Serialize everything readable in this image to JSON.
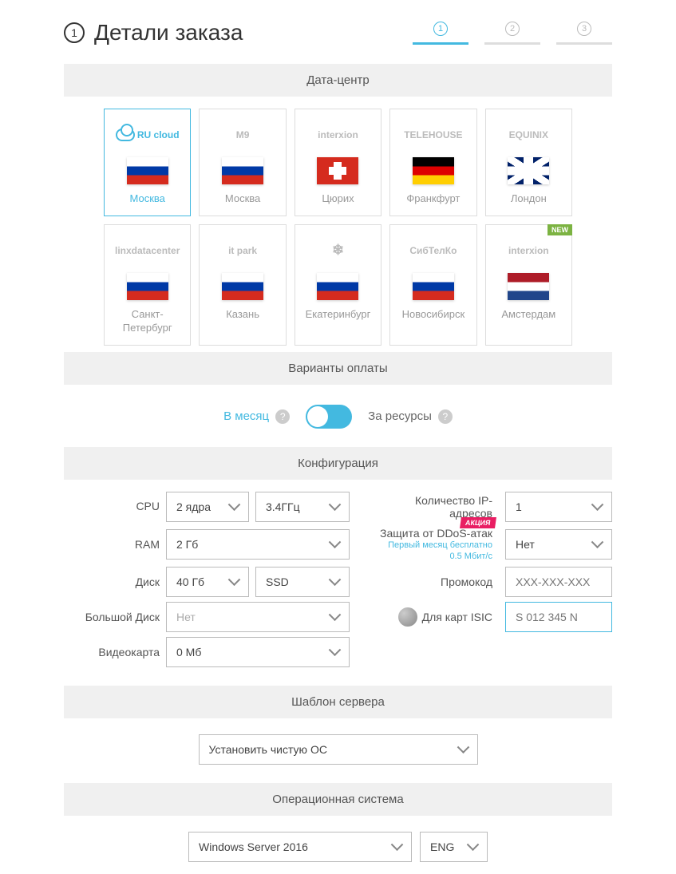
{
  "header": {
    "step_num": "1",
    "title": "Детали заказа",
    "tabs": [
      "1",
      "2",
      "3"
    ]
  },
  "sections": {
    "datacenter": "Дата-центр",
    "payment": "Варианты оплаты",
    "config": "Конфигурация",
    "template": "Шаблон сервера",
    "os": "Операционная система"
  },
  "datacenters": [
    {
      "logo": "RU cloud",
      "city": "Москва",
      "flag": "ru",
      "selected": true
    },
    {
      "logo": "М9",
      "city": "Москва",
      "flag": "ru"
    },
    {
      "logo": "interxion",
      "city": "Цюрих",
      "flag": "ch"
    },
    {
      "logo": "TELEHOUSE",
      "city": "Франкфурт",
      "flag": "de"
    },
    {
      "logo": "EQUINIX",
      "city": "Лондон",
      "flag": "uk"
    },
    {
      "logo": "linxdatacenter",
      "city": "Санкт-Петербург",
      "flag": "ru"
    },
    {
      "logo": "it park",
      "city": "Казань",
      "flag": "ru"
    },
    {
      "logo": "❄",
      "city": "Екатеринбург",
      "flag": "ru"
    },
    {
      "logo": "СибТелКо",
      "city": "Новосибирск",
      "flag": "ru"
    },
    {
      "logo": "interxion",
      "city": "Амстердам",
      "flag": "nl",
      "new": true
    }
  ],
  "payment": {
    "monthly": "В месяц",
    "resources": "За ресурсы",
    "new_badge": "NEW"
  },
  "config": {
    "cpu_label": "CPU",
    "cpu_cores": "2 ядра",
    "cpu_freq": "3.4ГГц",
    "ram_label": "RAM",
    "ram_value": "2 Гб",
    "disk_label": "Диск",
    "disk_size": "40 Гб",
    "disk_type": "SSD",
    "bigdisk_label": "Большой Диск",
    "bigdisk_value": "Нет",
    "gpu_label": "Видеокарта",
    "gpu_value": "0 Мб",
    "ip_label": "Количество IP-адресов",
    "ip_value": "1",
    "ddos_label": "Защита от DDoS-атак",
    "ddos_sub1": "Первый месяц бесплатно",
    "ddos_sub2": "0.5 Мбит/с",
    "ddos_value": "Нет",
    "ddos_badge": "АКЦИЯ",
    "promo_label": "Промокод",
    "promo_placeholder": "XXX-XXX-XXX",
    "isic_label": "Для карт ISIC",
    "isic_placeholder": "S 012 345 N"
  },
  "template": {
    "value": "Установить чистую ОС"
  },
  "os": {
    "value": "Windows Server 2016",
    "lang": "ENG"
  }
}
